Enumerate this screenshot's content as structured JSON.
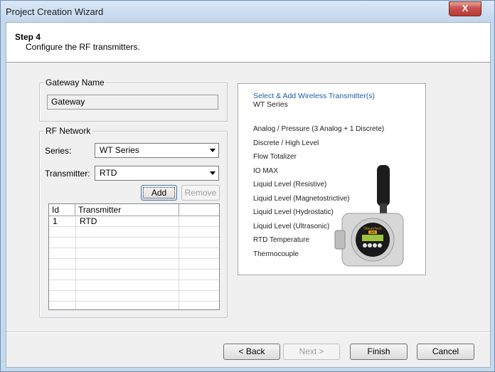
{
  "window": {
    "title": "Project Creation Wizard",
    "close_glyph": "X"
  },
  "header": {
    "step_title": "Step 4",
    "step_description": "Configure the RF transmitters."
  },
  "gateway": {
    "group_label": "Gateway Name",
    "value": "Gateway"
  },
  "rf_network": {
    "group_label": "RF Network",
    "series_label": "Series:",
    "series_value": "WT Series",
    "transmitter_label": "Transmitter:",
    "transmitter_value": "RTD",
    "add_label": "Add",
    "remove_label": "Remove",
    "table": {
      "columns": [
        "Id",
        "Transmitter"
      ],
      "rows": [
        {
          "id": "1",
          "transmitter": "RTD"
        }
      ]
    }
  },
  "product_panel": {
    "title": "Select & Add Wireless Transmitter(s)",
    "subtitle": "WT Series",
    "items": [
      "Analog / Pressure (3 Analog + 1 Discrete)",
      "Discrete / High Level",
      "Flow Totalizer",
      "IO MAX",
      "Liquid Level (Resistive)",
      "Liquid Level (Magnetostrictive)",
      "Liquid Level (Hydrostatic)",
      "Liquid Level (Ultrasonic)",
      "RTD Temperature",
      "Thermocouple"
    ],
    "device_brand": "OleumTech",
    "device_badge": "OTI"
  },
  "footer": {
    "back_label": "< Back",
    "next_label": "Next >",
    "finish_label": "Finish",
    "cancel_label": "Cancel"
  }
}
